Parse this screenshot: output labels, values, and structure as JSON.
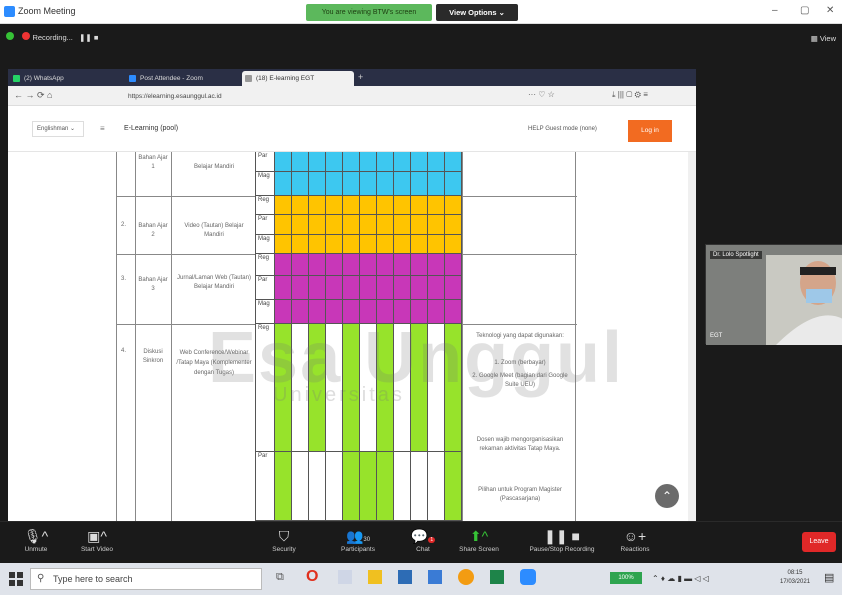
{
  "zoom": {
    "window_title": "Zoom Meeting",
    "share_banner": "You are viewing BTW's screen",
    "view_options": "View Options ⌄",
    "recording": "Recording...",
    "view_label": "View"
  },
  "browser": {
    "tabs": [
      {
        "label": "(2) WhatsApp",
        "color": "#25d366"
      },
      {
        "label": "Post Attendee - Zoom",
        "color": "#2d8cff"
      },
      {
        "label": "(18) E-learning EGT",
        "color": "#ffffff"
      }
    ],
    "url": "https://elearning.esaunggul.ac.id",
    "site_dropdown": "Englishman ⌄",
    "site_name": "E-Learning (pool)",
    "mode_text": "HELP Guest mode (none)",
    "login_button": "Log in"
  },
  "table": {
    "rows": [
      {
        "no": "",
        "topic": "Bahan Ajar 1",
        "activity": "Belajar Mandiri",
        "labels": [
          "Par",
          "Mag"
        ]
      },
      {
        "no": "2.",
        "topic": "Bahan Ajar 2",
        "activity": "Video (Tautan) Belajar Mandiri",
        "labels": [
          "Reg",
          "Par",
          "Mag"
        ]
      },
      {
        "no": "3.",
        "topic": "Bahan Ajar 3",
        "activity": "Jurnal/Laman Web (Tautan) Belajar Mandiri",
        "labels": [
          "Reg",
          "Par",
          "Mag"
        ]
      },
      {
        "no": "4.",
        "topic": "Diskusi Sinkron",
        "activity": "Web Conference/Webinar /Tatap Maya (Komplementer dengan Tugas)",
        "labels": [
          "Reg",
          "Par"
        ]
      }
    ],
    "notes": [
      "Teknologi yang dapat digunakan:",
      "1. Zoom (berbayar)",
      "2. Google Meet (bagian dari Google Suite UEU)",
      "Dosen wajib mengorganisasikan rekaman aktivitas Tatap Maya.",
      "Pilihan untuk Program Magister (Pascasarjana)"
    ],
    "colors": {
      "cyan": "#3dc8f0",
      "yellow": "#ffc400",
      "magenta": "#c837b8",
      "green": "#97e32b"
    }
  },
  "watermark": {
    "small": "Universitas",
    "large": "Esa Unggul"
  },
  "speaker": {
    "name": "Dr. Lolo Spotlight",
    "label": "EGT"
  },
  "toolbar": {
    "unmute": "Unmute",
    "start_video": "Start Video",
    "security": "Security",
    "participants": "Participants",
    "participants_count": "30",
    "chat": "Chat",
    "chat_badge": "1",
    "share_screen": "Share Screen",
    "record": "Pause/Stop Recording",
    "reactions": "Reactions",
    "leave": "Leave"
  },
  "taskbar": {
    "search_placeholder": "Type here to search",
    "battery": "100%",
    "time": "08:15",
    "date": "17/03/2021"
  }
}
